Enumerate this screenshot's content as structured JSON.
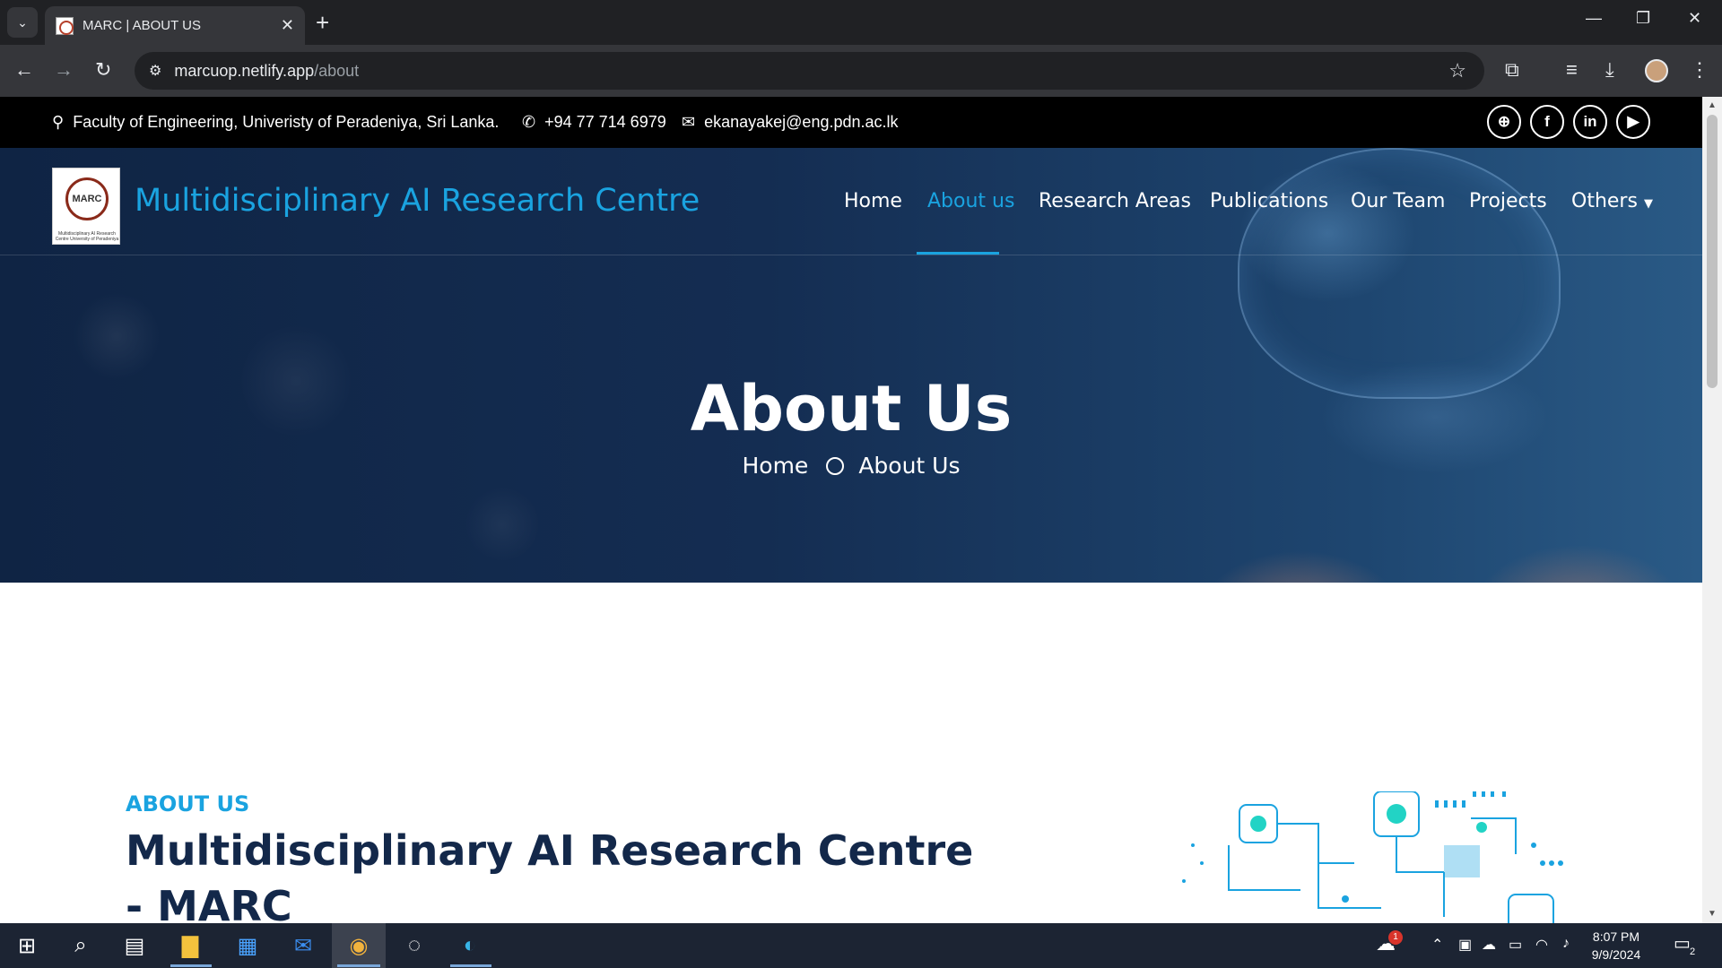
{
  "browser": {
    "tab_title": "MARC | ABOUT US",
    "new_tab_icon": "+",
    "tab_close_icon": "✕",
    "url_host": "marcuop.netlify.app",
    "url_path": "/about"
  },
  "topbar": {
    "address": "Faculty of Engineering, Univeristy of Peradeniya, Sri Lanka.",
    "phone": "+94 77 714 6979",
    "email": "ekanayakej@eng.pdn.ac.lk",
    "social": [
      {
        "icon": "globe-icon",
        "glyph": "⊕"
      },
      {
        "icon": "facebook-icon",
        "glyph": "f"
      },
      {
        "icon": "linkedin-icon",
        "glyph": "in"
      },
      {
        "icon": "youtube-icon",
        "glyph": "▶"
      }
    ]
  },
  "header": {
    "logo_text": "MARC",
    "logo_subtitle": "Multidisciplinary AI Research Centre University of Peradeniya",
    "brand": "Multidisciplinary AI Research Centre",
    "menu": [
      "Home",
      "About us",
      "Research Areas",
      "Publications",
      "Our Team",
      "Projects",
      "Others"
    ],
    "active_menu": "About us",
    "accent_color": "#1aa3e0"
  },
  "hero": {
    "title": "About Us",
    "breadcrumb": [
      "Home",
      "About Us"
    ]
  },
  "content": {
    "eyebrow": "ABOUT US",
    "heading": "Multidisciplinary AI Research Centre - MARC"
  },
  "taskbar": {
    "apps": [
      "windows-start-icon",
      "search-icon",
      "task-view-icon",
      "file-explorer-icon",
      "microsoft-store-icon",
      "mail-icon",
      "chrome-icon",
      "whatsapp-icon",
      "edge-icon"
    ],
    "weather_badge": "1",
    "notification_count": "2",
    "time": "8:07 PM",
    "date": "9/9/2024"
  }
}
